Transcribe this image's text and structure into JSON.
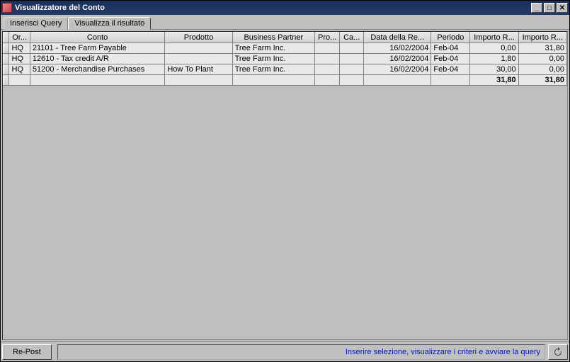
{
  "window": {
    "title": "Visualizzatore del Conto"
  },
  "tabs": [
    {
      "label": "Inserisci Query",
      "active": false
    },
    {
      "label": "Visualizza il risultato",
      "active": true
    }
  ],
  "table": {
    "headers": [
      "Or...",
      "Conto",
      "Prodotto",
      "Business Partner",
      "Pro...",
      "Ca...",
      "Data della Re...",
      "Periodo",
      "Importo R...",
      "Importo R..."
    ],
    "rows": [
      {
        "org": "HQ",
        "conto": "21101 - Tree Farm Payable",
        "prodotto": "",
        "partner": "Tree Farm Inc.",
        "pro": "",
        "ca": "",
        "data": "16/02/2004",
        "periodo": "Feb-04",
        "imp1": "0,00",
        "imp2": "31,80"
      },
      {
        "org": "HQ",
        "conto": "12610 - Tax credit A/R",
        "prodotto": "",
        "partner": "Tree Farm Inc.",
        "pro": "",
        "ca": "",
        "data": "16/02/2004",
        "periodo": "Feb-04",
        "imp1": "1,80",
        "imp2": "0,00"
      },
      {
        "org": "HQ",
        "conto": "51200 - Merchandise Purchases",
        "prodotto": "How To Plant",
        "partner": "Tree Farm Inc.",
        "pro": "",
        "ca": "",
        "data": "16/02/2004",
        "periodo": "Feb-04",
        "imp1": "30,00",
        "imp2": "0,00"
      }
    ],
    "totals": {
      "imp1": "31,80",
      "imp2": "31,80"
    }
  },
  "footer": {
    "repost_label": "Re-Post",
    "status": "Inserire selezione, visualizzare i criteri e avviare la query"
  }
}
